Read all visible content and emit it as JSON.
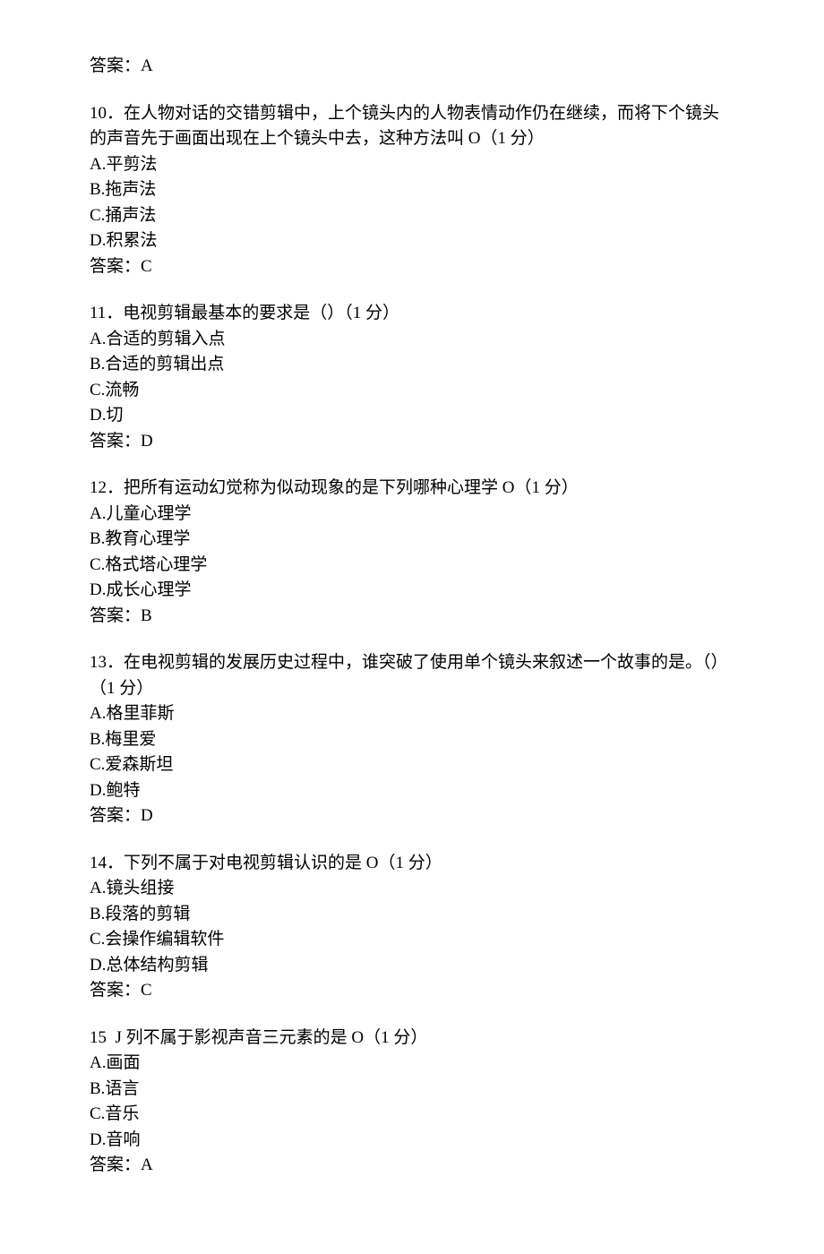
{
  "prev_answer": {
    "label": "答案：",
    "value": "A"
  },
  "questions": [
    {
      "num": "10",
      "stem_lines": [
        "．在人物对话的交错剪辑中，上个镜头内的人物表情动作仍在继续，而将下个镜头的声音先于画面出现在上个镜头中去，这种方法叫 O（1 分）"
      ],
      "options": [
        "A.平剪法",
        "B.拖声法",
        "C.捅声法",
        "D.积累法"
      ],
      "answer_label": "答案：",
      "answer": "C"
    },
    {
      "num": "11",
      "stem_lines": [
        "．电视剪辑最基本的要求是（）（1 分）"
      ],
      "options": [
        "A.合适的剪辑入点",
        "B.合适的剪辑出点",
        "C.流畅",
        "D.切"
      ],
      "answer_label": "答案：",
      "answer": "D"
    },
    {
      "num": "12",
      "stem_lines": [
        "．把所有运动幻觉称为似动现象的是下列哪种心理学 O（1 分）"
      ],
      "options": [
        "A.儿童心理学",
        "B.教育心理学",
        "C.格式塔心理学",
        "D.成长心理学"
      ],
      "answer_label": "答案：",
      "answer": "B"
    },
    {
      "num": "13",
      "stem_lines": [
        "．在电视剪辑的发展历史过程中，谁突破了使用单个镜头来叙述一个故事的是。（）（1 分）"
      ],
      "options": [
        "A.格里菲斯",
        "B.梅里爱",
        "C.爱森斯坦",
        "D.鲍特"
      ],
      "answer_label": "答案：",
      "answer": "D"
    },
    {
      "num": "14",
      "stem_lines": [
        "．下列不属于对电视剪辑认识的是 O（1 分）"
      ],
      "options": [
        "A.镜头组接",
        "B.段落的剪辑",
        "C.会操作编辑软件",
        "D.总体结构剪辑"
      ],
      "answer_label": "答案：",
      "answer": "C"
    },
    {
      "num": "15",
      "stem_lines": [
        "  J 列不属于影视声音三元素的是 O（1 分）"
      ],
      "options": [
        "A.画面",
        "B.语言",
        "C.音乐",
        "D.音响"
      ],
      "answer_label": "答案：",
      "answer": "A"
    }
  ]
}
